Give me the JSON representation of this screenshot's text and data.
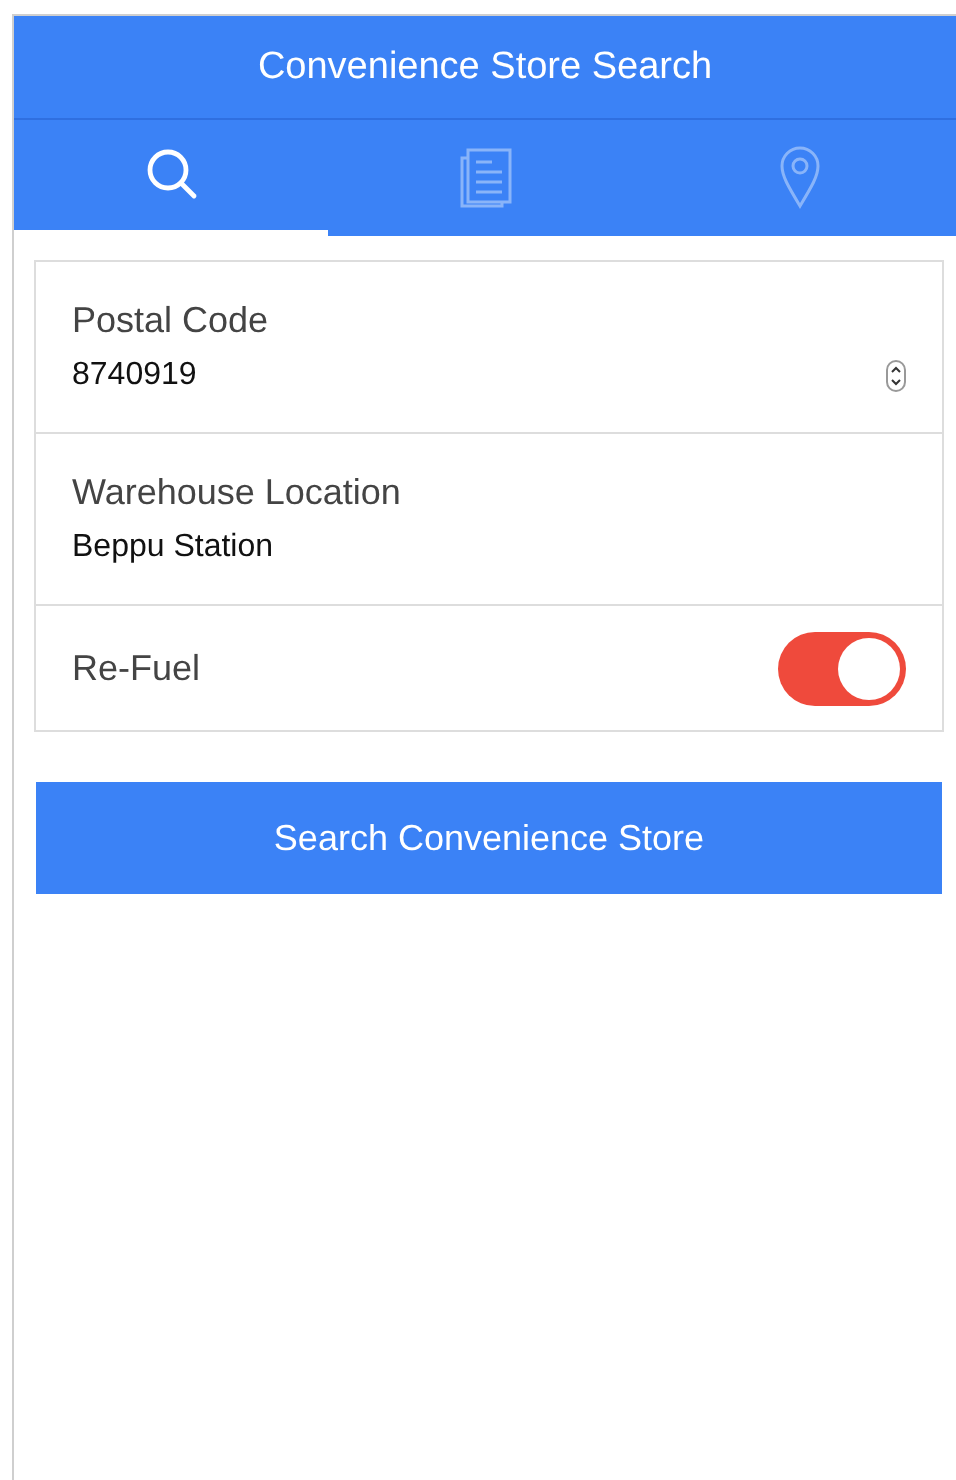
{
  "header": {
    "title": "Convenience Store Search"
  },
  "tabs": [
    {
      "kind": "search",
      "selected": true
    },
    {
      "kind": "list",
      "selected": false
    },
    {
      "kind": "pin",
      "selected": false
    }
  ],
  "form": [
    {
      "kind": "number",
      "label": "Postal Code",
      "value": "8740919"
    },
    {
      "kind": "text",
      "label": "Warehouse Location",
      "value": "Beppu Station"
    },
    {
      "kind": "toggle",
      "label": "Re-Fuel",
      "on": true
    }
  ],
  "button": "Search Convenience Store"
}
